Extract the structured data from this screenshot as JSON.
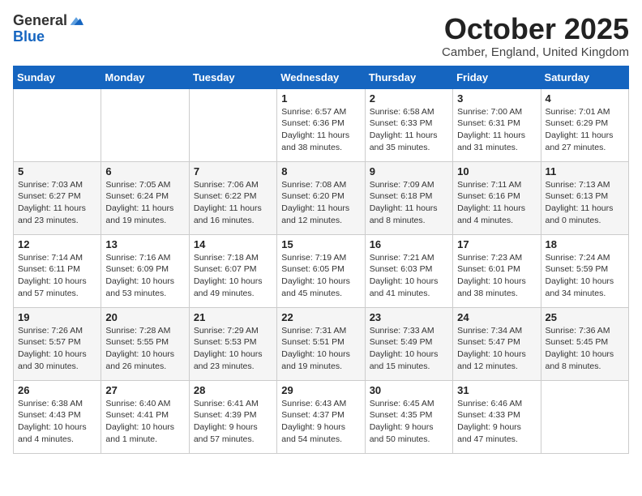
{
  "header": {
    "logo_general": "General",
    "logo_blue": "Blue",
    "month_title": "October 2025",
    "location": "Camber, England, United Kingdom"
  },
  "weekdays": [
    "Sunday",
    "Monday",
    "Tuesday",
    "Wednesday",
    "Thursday",
    "Friday",
    "Saturday"
  ],
  "weeks": [
    [
      {
        "day": "",
        "info": ""
      },
      {
        "day": "",
        "info": ""
      },
      {
        "day": "",
        "info": ""
      },
      {
        "day": "1",
        "info": "Sunrise: 6:57 AM\nSunset: 6:36 PM\nDaylight: 11 hours\nand 38 minutes."
      },
      {
        "day": "2",
        "info": "Sunrise: 6:58 AM\nSunset: 6:33 PM\nDaylight: 11 hours\nand 35 minutes."
      },
      {
        "day": "3",
        "info": "Sunrise: 7:00 AM\nSunset: 6:31 PM\nDaylight: 11 hours\nand 31 minutes."
      },
      {
        "day": "4",
        "info": "Sunrise: 7:01 AM\nSunset: 6:29 PM\nDaylight: 11 hours\nand 27 minutes."
      }
    ],
    [
      {
        "day": "5",
        "info": "Sunrise: 7:03 AM\nSunset: 6:27 PM\nDaylight: 11 hours\nand 23 minutes."
      },
      {
        "day": "6",
        "info": "Sunrise: 7:05 AM\nSunset: 6:24 PM\nDaylight: 11 hours\nand 19 minutes."
      },
      {
        "day": "7",
        "info": "Sunrise: 7:06 AM\nSunset: 6:22 PM\nDaylight: 11 hours\nand 16 minutes."
      },
      {
        "day": "8",
        "info": "Sunrise: 7:08 AM\nSunset: 6:20 PM\nDaylight: 11 hours\nand 12 minutes."
      },
      {
        "day": "9",
        "info": "Sunrise: 7:09 AM\nSunset: 6:18 PM\nDaylight: 11 hours\nand 8 minutes."
      },
      {
        "day": "10",
        "info": "Sunrise: 7:11 AM\nSunset: 6:16 PM\nDaylight: 11 hours\nand 4 minutes."
      },
      {
        "day": "11",
        "info": "Sunrise: 7:13 AM\nSunset: 6:13 PM\nDaylight: 11 hours\nand 0 minutes."
      }
    ],
    [
      {
        "day": "12",
        "info": "Sunrise: 7:14 AM\nSunset: 6:11 PM\nDaylight: 10 hours\nand 57 minutes."
      },
      {
        "day": "13",
        "info": "Sunrise: 7:16 AM\nSunset: 6:09 PM\nDaylight: 10 hours\nand 53 minutes."
      },
      {
        "day": "14",
        "info": "Sunrise: 7:18 AM\nSunset: 6:07 PM\nDaylight: 10 hours\nand 49 minutes."
      },
      {
        "day": "15",
        "info": "Sunrise: 7:19 AM\nSunset: 6:05 PM\nDaylight: 10 hours\nand 45 minutes."
      },
      {
        "day": "16",
        "info": "Sunrise: 7:21 AM\nSunset: 6:03 PM\nDaylight: 10 hours\nand 41 minutes."
      },
      {
        "day": "17",
        "info": "Sunrise: 7:23 AM\nSunset: 6:01 PM\nDaylight: 10 hours\nand 38 minutes."
      },
      {
        "day": "18",
        "info": "Sunrise: 7:24 AM\nSunset: 5:59 PM\nDaylight: 10 hours\nand 34 minutes."
      }
    ],
    [
      {
        "day": "19",
        "info": "Sunrise: 7:26 AM\nSunset: 5:57 PM\nDaylight: 10 hours\nand 30 minutes."
      },
      {
        "day": "20",
        "info": "Sunrise: 7:28 AM\nSunset: 5:55 PM\nDaylight: 10 hours\nand 26 minutes."
      },
      {
        "day": "21",
        "info": "Sunrise: 7:29 AM\nSunset: 5:53 PM\nDaylight: 10 hours\nand 23 minutes."
      },
      {
        "day": "22",
        "info": "Sunrise: 7:31 AM\nSunset: 5:51 PM\nDaylight: 10 hours\nand 19 minutes."
      },
      {
        "day": "23",
        "info": "Sunrise: 7:33 AM\nSunset: 5:49 PM\nDaylight: 10 hours\nand 15 minutes."
      },
      {
        "day": "24",
        "info": "Sunrise: 7:34 AM\nSunset: 5:47 PM\nDaylight: 10 hours\nand 12 minutes."
      },
      {
        "day": "25",
        "info": "Sunrise: 7:36 AM\nSunset: 5:45 PM\nDaylight: 10 hours\nand 8 minutes."
      }
    ],
    [
      {
        "day": "26",
        "info": "Sunrise: 6:38 AM\nSunset: 4:43 PM\nDaylight: 10 hours\nand 4 minutes."
      },
      {
        "day": "27",
        "info": "Sunrise: 6:40 AM\nSunset: 4:41 PM\nDaylight: 10 hours\nand 1 minute."
      },
      {
        "day": "28",
        "info": "Sunrise: 6:41 AM\nSunset: 4:39 PM\nDaylight: 9 hours\nand 57 minutes."
      },
      {
        "day": "29",
        "info": "Sunrise: 6:43 AM\nSunset: 4:37 PM\nDaylight: 9 hours\nand 54 minutes."
      },
      {
        "day": "30",
        "info": "Sunrise: 6:45 AM\nSunset: 4:35 PM\nDaylight: 9 hours\nand 50 minutes."
      },
      {
        "day": "31",
        "info": "Sunrise: 6:46 AM\nSunset: 4:33 PM\nDaylight: 9 hours\nand 47 minutes."
      },
      {
        "day": "",
        "info": ""
      }
    ]
  ]
}
